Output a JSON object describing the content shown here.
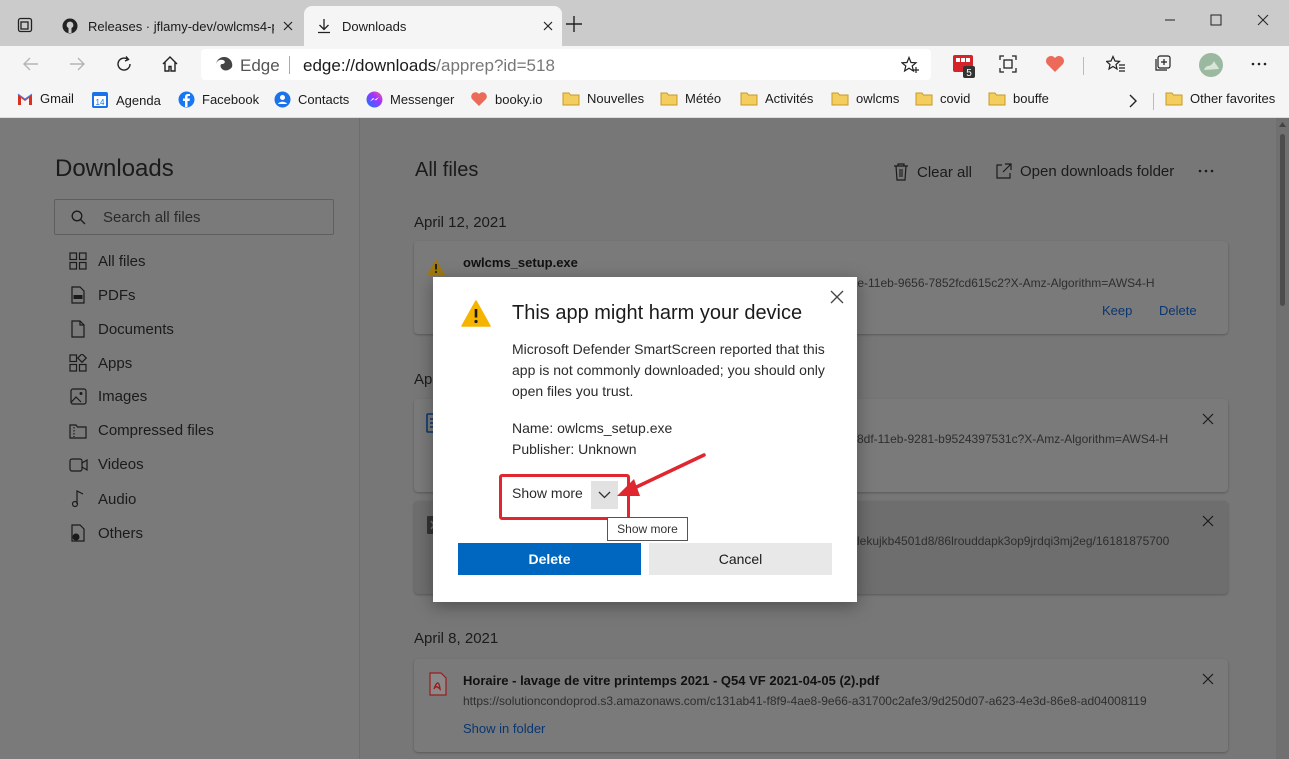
{
  "tabs": [
    {
      "title": "Releases · jflamy-dev/owlcms4-p",
      "icon": "github-icon"
    },
    {
      "title": "Downloads",
      "icon": "download-icon"
    }
  ],
  "address": {
    "site": "Edge",
    "url_host": "edge://downloads",
    "url_path": "/apprep?id=518"
  },
  "extensions": {
    "badge": "5"
  },
  "favorites": [
    {
      "label": "Gmail"
    },
    {
      "label": "Agenda",
      "badge": "14"
    },
    {
      "label": "Facebook"
    },
    {
      "label": "Contacts"
    },
    {
      "label": "Messenger"
    },
    {
      "label": "booky.io"
    },
    {
      "label": "Nouvelles"
    },
    {
      "label": "Météo"
    },
    {
      "label": "Activités"
    },
    {
      "label": "owlcms"
    },
    {
      "label": "covid"
    },
    {
      "label": "bouffe"
    },
    {
      "label": "Other favorites"
    }
  ],
  "sidebar": {
    "title": "Downloads",
    "search_placeholder": "Search all files",
    "items": [
      {
        "label": "All files"
      },
      {
        "label": "PDFs"
      },
      {
        "label": "Documents"
      },
      {
        "label": "Apps"
      },
      {
        "label": "Images"
      },
      {
        "label": "Compressed files"
      },
      {
        "label": "Videos"
      },
      {
        "label": "Audio"
      },
      {
        "label": "Others"
      }
    ]
  },
  "main": {
    "title": "All files",
    "clear_all": "Clear all",
    "open_folder": "Open downloads folder",
    "groups": [
      {
        "date": "April 12, 2021"
      },
      {
        "date": "Ap"
      },
      {
        "date": "April 8, 2021"
      }
    ],
    "items": [
      {
        "name": "owlcms_setup.exe",
        "url": "bae-11eb-9656-7852fcd615c2?X-Amz-Algorithm=AWS4-H",
        "keep": "Keep",
        "delete": "Delete"
      },
      {
        "url": "8df-11eb-9281-b9524397531c?X-Amz-Algorithm=AWS4-H"
      },
      {
        "url": "lekujkb4501d8/86lrouddapk3op9jrdqi3mj2eg/16181875700"
      },
      {
        "name": "Horaire - lavage de vitre printemps 2021 - Q54 VF 2021-04-05 (2).pdf",
        "url": "https://solutioncondoprod.s3.amazonaws.com/c131ab41-f8f9-4ae8-9e66-a31700c2afe3/9d250d07-a623-4e3d-86e8-ad04008119",
        "show_in_folder": "Show in folder"
      }
    ]
  },
  "dialog": {
    "title": "This app might harm your device",
    "message": "Microsoft Defender SmartScreen reported that this app is not commonly downloaded; you should only open files you trust.",
    "name_line": "Name: owlcms_setup.exe",
    "publisher_line": "Publisher: Unknown",
    "show_more": "Show more",
    "tooltip": "Show more",
    "delete_button": "Delete",
    "cancel_button": "Cancel"
  },
  "colors": {
    "accent": "#0067c0",
    "annotation": "#e0262e",
    "warning": "#f5b400"
  }
}
